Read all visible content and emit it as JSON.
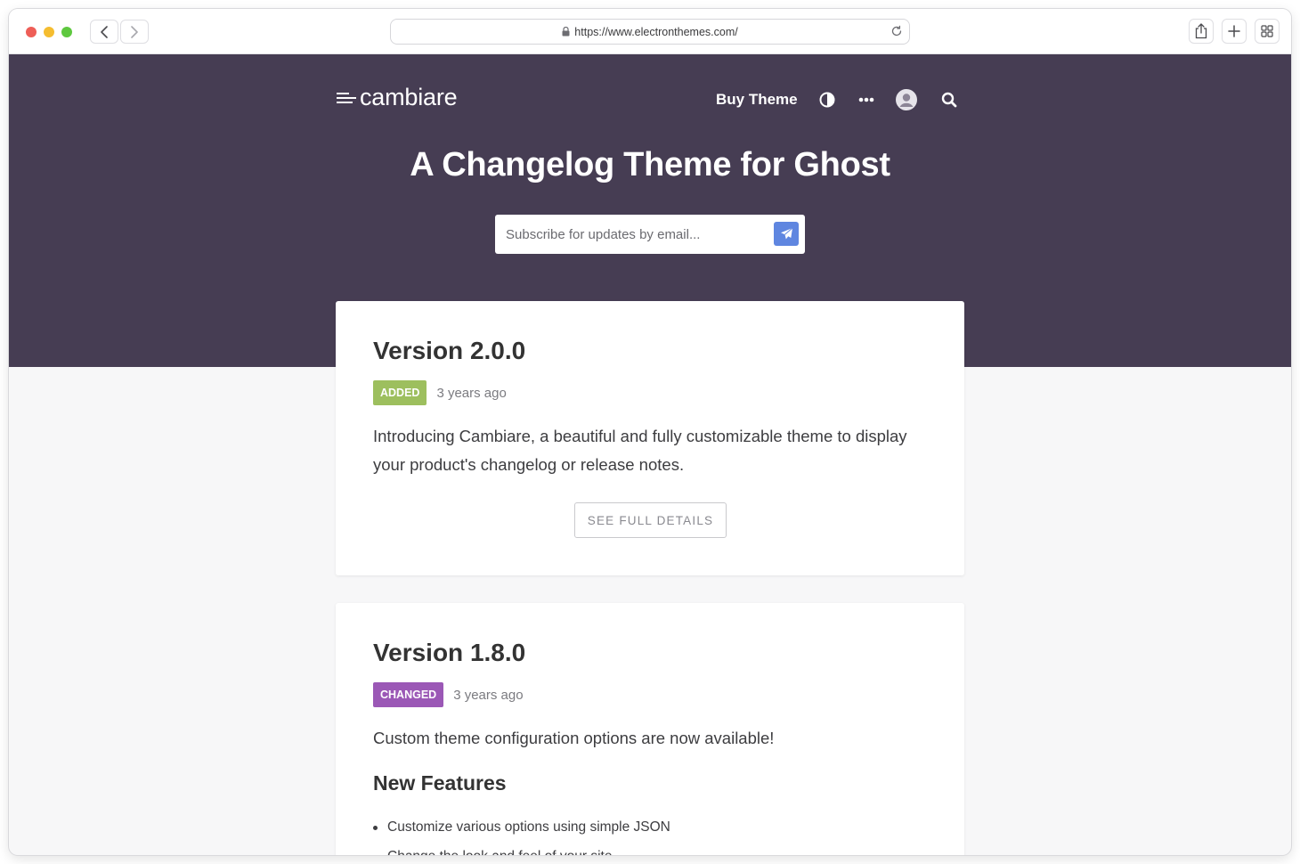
{
  "browser": {
    "url": "https://www.electronthemes.com/"
  },
  "site": {
    "logo_text": "cambiare",
    "nav": {
      "buy_label": "Buy Theme"
    },
    "hero_title": "A Changelog Theme for Ghost",
    "subscribe_placeholder": "Subscribe for updates by email..."
  },
  "posts": [
    {
      "title": "Version 2.0.0",
      "tag": "ADDED",
      "tag_color": "#9dbf5e",
      "time": "3 years ago",
      "excerpt": "Introducing Cambiare, a beautiful and fully customizable theme to display your product's changelog or release notes.",
      "details_label": "SEE FULL DETAILS"
    },
    {
      "title": "Version 1.8.0",
      "tag": "CHANGED",
      "tag_color": "#9b58b6",
      "time": "3 years ago",
      "excerpt": "Custom theme configuration options are now available!",
      "section_heading": "New Features",
      "features": [
        "Customize various options using simple JSON",
        "Change the look and feel of your site"
      ]
    }
  ],
  "colors": {
    "hero_bg": "#463d53",
    "page_bg": "#f7f7f8",
    "accent_blue": "#5f86e0"
  }
}
